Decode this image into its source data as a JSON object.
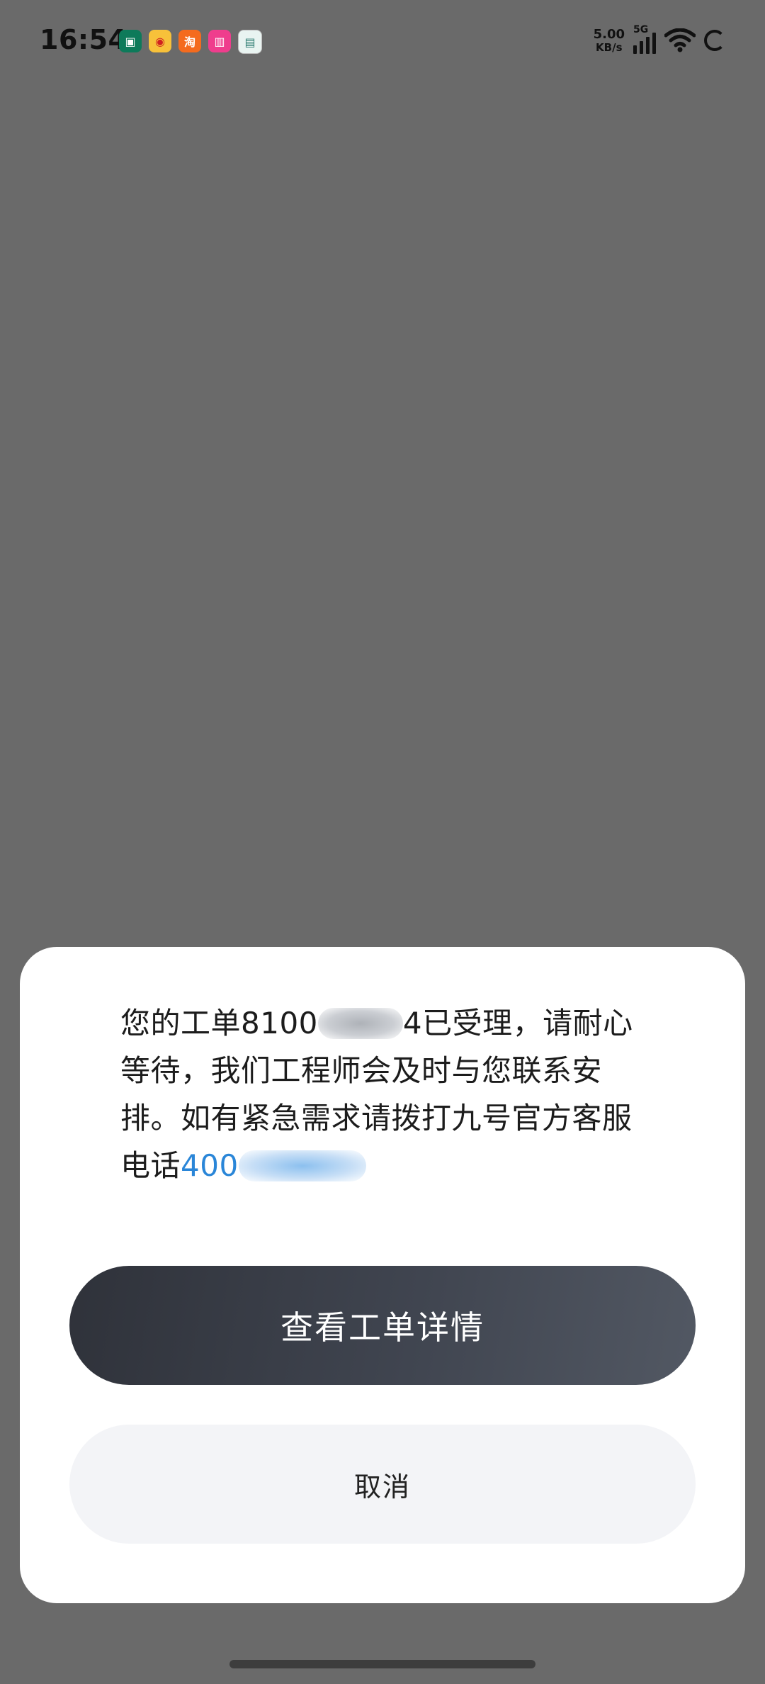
{
  "status_bar": {
    "time": "16:54",
    "net_speed_value": "5.00",
    "net_speed_unit": "KB/s",
    "network_generation": "5G",
    "app_icons": [
      "game-icon",
      "weibo-icon",
      "taobao-icon",
      "bilibili-icon",
      "notes-icon"
    ],
    "app_icon_glyphs": [
      "▣",
      "◉",
      "淘",
      "▥",
      "▤"
    ]
  },
  "dialog": {
    "message_prefix": "您的工单8100",
    "message_after_blur": "4已受理，请耐心等待，我们工程师会及时与您联系安排。如有紧急需求请拨打九号官方客服电话",
    "phone_prefix": "400",
    "primary_button_label": "查看工单详情",
    "cancel_button_label": "取消"
  },
  "colors": {
    "overlay": "#6a6a6a",
    "sheet": "#ffffff",
    "primary_button": "#3a3e47",
    "secondary_button": "#f3f4f7",
    "link": "#2a86d8"
  }
}
